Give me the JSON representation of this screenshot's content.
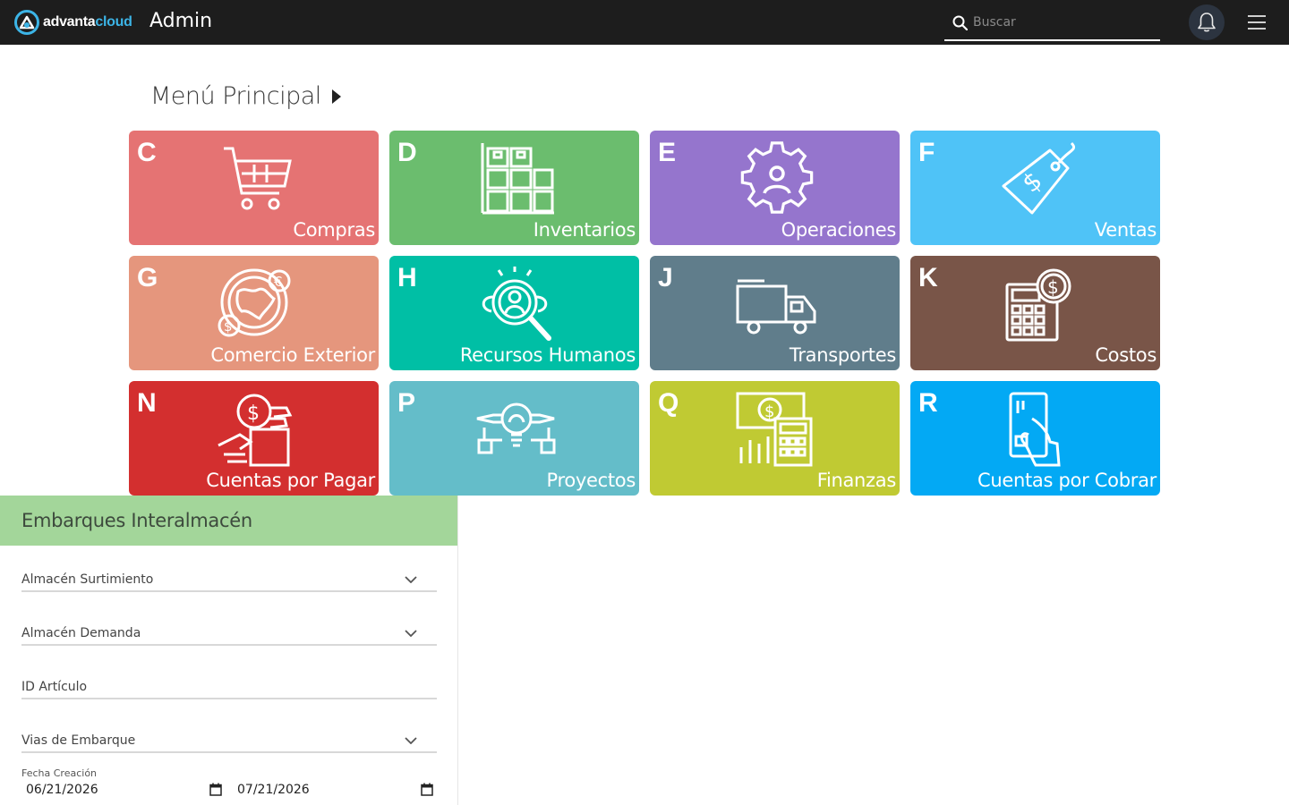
{
  "header": {
    "logo_text_main": "advanta",
    "logo_text_accent": "cloud",
    "app_title": "Admin",
    "search_placeholder": "Buscar",
    "bell_icon": "bell-icon",
    "menu_icon": "hamburger-icon"
  },
  "menu": {
    "title": "Menú Principal",
    "tiles": [
      {
        "letter": "C",
        "label": "Compras",
        "color": "#e57373",
        "icon": "cart-icon"
      },
      {
        "letter": "D",
        "label": "Inventarios",
        "color": "#6bbd6e",
        "icon": "boxes-icon"
      },
      {
        "letter": "E",
        "label": "Operaciones",
        "color": "#9575cd",
        "icon": "gear-person-icon"
      },
      {
        "letter": "F",
        "label": "Ventas",
        "color": "#4fc3f7",
        "icon": "price-tag-icon"
      },
      {
        "letter": "G",
        "label": "Comercio Exterior",
        "color": "#e5967d",
        "icon": "globe-currency-icon"
      },
      {
        "letter": "H",
        "label": "Recursos Humanos",
        "color": "#00bfa5",
        "icon": "person-search-icon"
      },
      {
        "letter": "J",
        "label": "Transportes",
        "color": "#607d8b",
        "icon": "truck-icon"
      },
      {
        "letter": "K",
        "label": "Costos",
        "color": "#795548",
        "icon": "calculator-coin-icon"
      },
      {
        "letter": "N",
        "label": "Cuentas por Pagar",
        "color": "#d32f2f",
        "icon": "hand-coin-icon"
      },
      {
        "letter": "P",
        "label": "Proyectos",
        "color": "#64bdc9",
        "icon": "lightbulb-icon"
      },
      {
        "letter": "Q",
        "label": "Finanzas",
        "color": "#c0ca33",
        "icon": "finance-calculator-icon"
      },
      {
        "letter": "R",
        "label": "Cuentas por Cobrar",
        "color": "#03a9f4",
        "icon": "hand-card-icon"
      }
    ]
  },
  "panel": {
    "title": "Embarques Interalmacén",
    "fields": {
      "almacen_surtimiento": "Almacén Surtimiento",
      "almacen_demanda": "Almacén Demanda",
      "id_articulo": "ID Artículo",
      "vias_embarque": "Vias de Embarque"
    },
    "fecha_label": "Fecha Creación",
    "fecha_desde": "06/21/2026",
    "fecha_hasta": "07/21/2026"
  }
}
